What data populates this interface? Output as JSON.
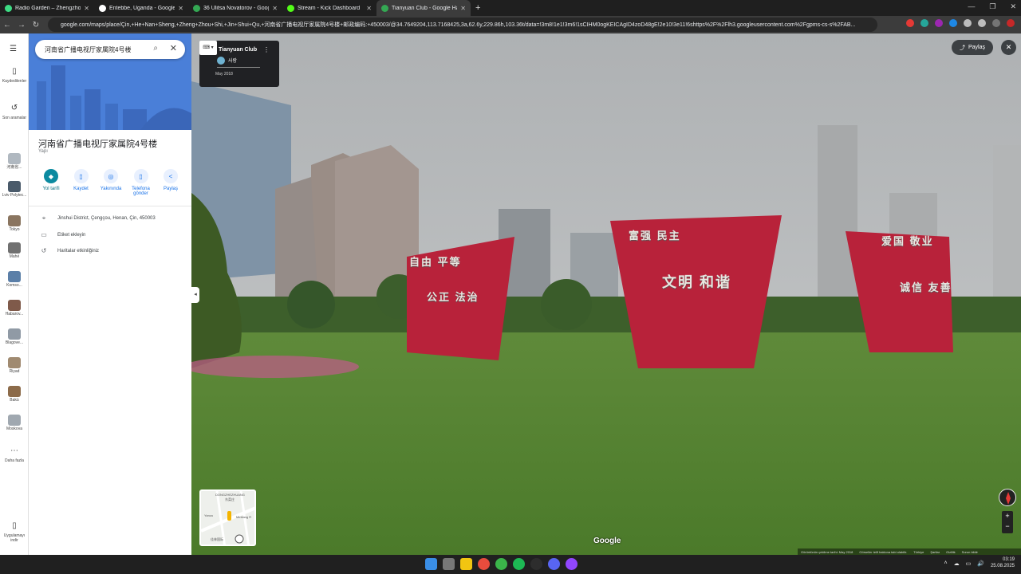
{
  "browser": {
    "tabs": [
      {
        "title": "Radio Garden – Zhengzhou",
        "color": "#3ddc84",
        "active": false
      },
      {
        "title": "Entebbe, Uganda - Google'da A",
        "color": "#ffffff",
        "active": false
      },
      {
        "title": "36 Ulitsa Novatorov - Google H",
        "color": "#34a853",
        "active": false
      },
      {
        "title": "Stream - Kick Dashboard",
        "color": "#53fc18",
        "active": false
      },
      {
        "title": "Tianyuan Club - Google Harita",
        "color": "#34a853",
        "active": true
      }
    ],
    "new_tab": "+",
    "url": "google.com/maps/place/Çin,+He+Nan+Sheng,+Zheng+Zhou+Shi,+Jin+Shui+Qu,+河南省广播电视厅家属院4号楼+邮政编码:+450003/@34.7649204,113.7168425,3a,62.6y,229.86h,103.36t/data=!3m8!1e1!3m6!1sCIHM0ogKEICAgID4zoD48gE!2e10!3e11!6shttps%2F%2Flh3.googleusercontent.com%2Fgpms-cs-s%2FAB..."
  },
  "rail": {
    "items": [
      {
        "label": "Kaydedilenler",
        "icon": "bookmark-icon"
      },
      {
        "label": "Son aramalar",
        "icon": "history-icon"
      },
      {
        "label": "河南省...",
        "icon": "thumb"
      },
      {
        "label": "Lviv Polytec...",
        "icon": "thumb"
      },
      {
        "label": "Tokyo",
        "icon": "thumb"
      },
      {
        "label": "Mahé",
        "icon": "thumb"
      },
      {
        "label": "Komso...",
        "icon": "thumb"
      },
      {
        "label": "Habarov...",
        "icon": "thumb"
      },
      {
        "label": "Blagove...",
        "icon": "thumb"
      },
      {
        "label": "Riyad",
        "icon": "thumb"
      },
      {
        "label": "Bakü",
        "icon": "thumb"
      },
      {
        "label": "Moskova",
        "icon": "thumb"
      },
      {
        "label": "Daha fazla",
        "icon": "more-icon"
      },
      {
        "label": "Uygulamayı indir",
        "icon": "phone-icon"
      }
    ]
  },
  "panel": {
    "search_value": "河南省广播电视厅家属院4号楼",
    "title": "河南省广播电视厅家属院4号楼",
    "type": "Yapı",
    "actions": [
      {
        "label": "Yol tarifi",
        "icon": "directions-icon"
      },
      {
        "label": "Kaydet",
        "icon": "bookmark-icon"
      },
      {
        "label": "Yakınında",
        "icon": "nearby-icon"
      },
      {
        "label": "Telefona gönder",
        "icon": "send-to-phone-icon"
      },
      {
        "label": "Paylaş",
        "icon": "share-icon"
      }
    ],
    "address": "Jinshui District, Çengçou, Henan, Çin, 450003",
    "label_link": "Etiket ekleyin",
    "activity_link": "Haritalar etkinliğiniz"
  },
  "streetview": {
    "place_name": "Tianyuan Club",
    "author": "사랑",
    "date": "May 2018",
    "share_label": "Paylaş",
    "minimap_labels": [
      "DONGZHEZHUANG",
      "东菜庄",
      "Yanzu",
      "Mintiang R",
      "佳林国际"
    ],
    "google_logo": "Google",
    "footer": [
      "Görüntünün çekilme tarihi: May 2018",
      "Görseller telif hakkına tabi olabilir.",
      "Türkiye",
      "Şartlar",
      "Gizlilik",
      "Sorun bildir"
    ],
    "sign_texts": [
      "自由 平等",
      "公正 法治",
      "富强 民主",
      "文明 和谐",
      "爱国 敬业",
      "诚信 友善"
    ]
  },
  "taskbar": {
    "time": "03:19",
    "date": "25.08.2025",
    "icon_colors": [
      "#3a8ee6",
      "#777777",
      "#f2c511",
      "#e84c3d",
      "#3bb54a",
      "#1db954",
      "#2d2d2d",
      "#5865f2",
      "#9146ff"
    ]
  }
}
